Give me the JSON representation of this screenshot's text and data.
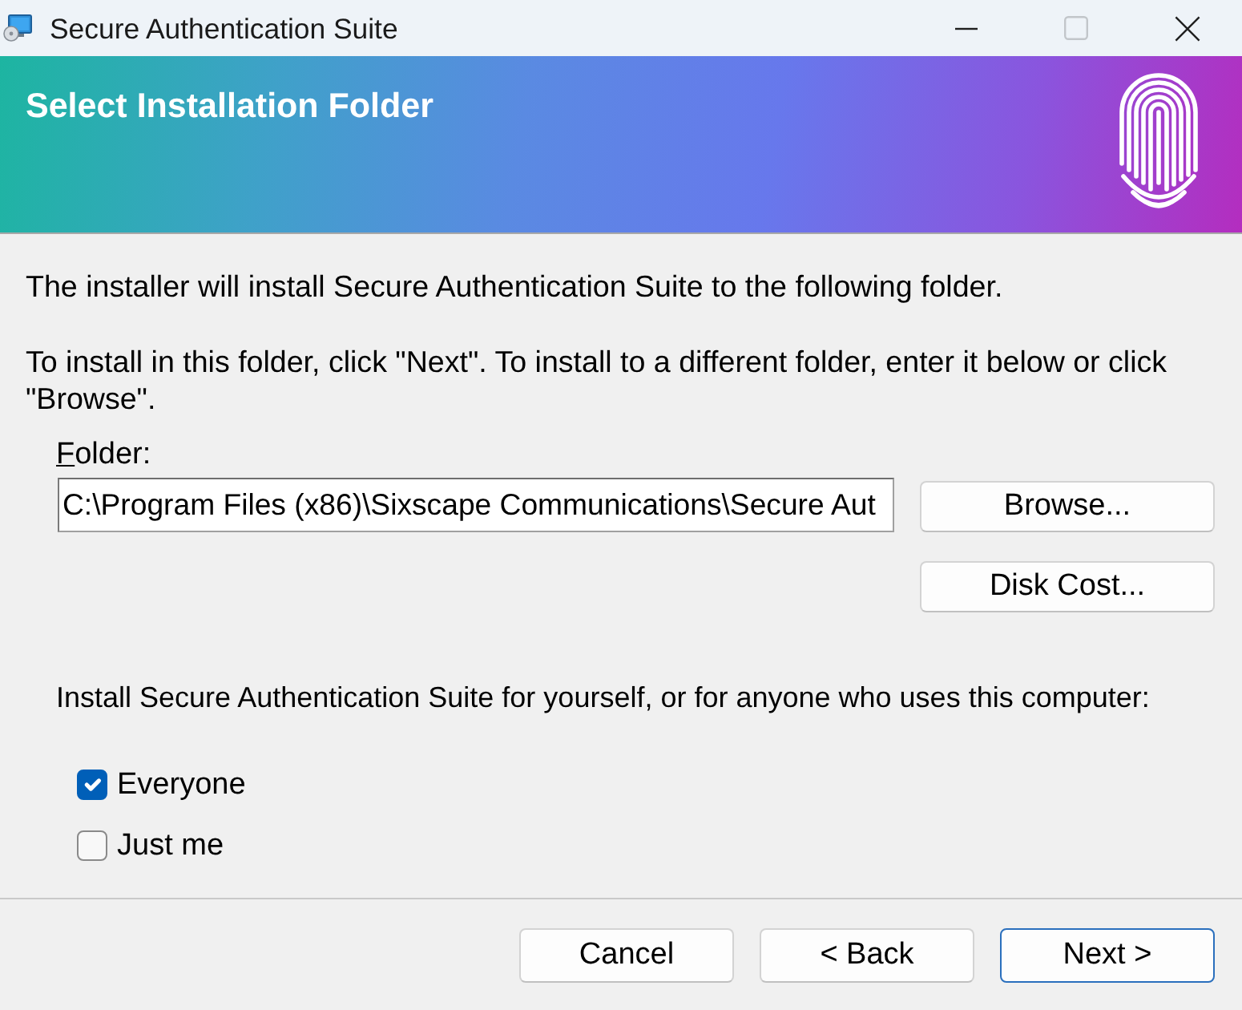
{
  "window": {
    "title": "Secure Authentication Suite",
    "controls": [
      {
        "kind": "minimize",
        "disabled": false
      },
      {
        "kind": "maximize",
        "disabled": true
      },
      {
        "kind": "close",
        "disabled": false
      }
    ]
  },
  "banner": {
    "title": "Select Installation Folder"
  },
  "intro": [
    "The installer will install Secure Authentication Suite to the following folder.",
    "To install in this folder, click \"Next\". To install to a different folder, enter it below or click \"Browse\"."
  ],
  "folder": {
    "label": "Folder:",
    "mnemonic": true,
    "value": "C:\\Program Files (x86)\\Sixscape Communications\\Secure Aut"
  },
  "folder_buttons": [
    "Browse...",
    "Disk Cost..."
  ],
  "scope": {
    "prompt": "Install Secure Authentication Suite for yourself, or for anyone who uses this computer:",
    "options": [
      {
        "label": "Everyone",
        "checked": true
      },
      {
        "label": "Just me",
        "checked": false
      }
    ]
  },
  "buttons": [
    {
      "label": "Cancel",
      "default": false
    },
    {
      "label": "< Back",
      "default": false
    },
    {
      "label": "Next >",
      "default": true
    }
  ]
}
